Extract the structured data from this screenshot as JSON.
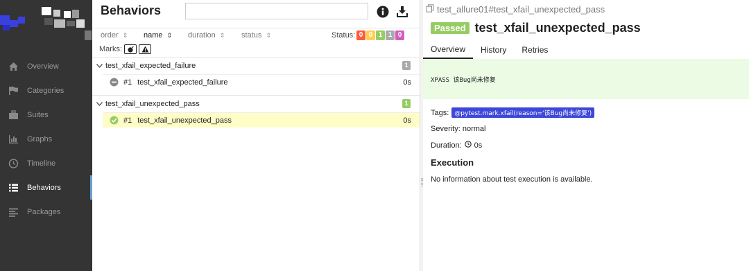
{
  "colors": {
    "sidebar_bg": "#343434",
    "status_failed": "#fd5a3e",
    "status_broken": "#ffd050",
    "status_passed": "#97cc64",
    "status_skipped": "#aaaaaa",
    "status_unknown": "#d35ebe",
    "tag_bg": "#3d47d9",
    "selected_row": "#fefdc7",
    "message_bg": "#ebfbe4"
  },
  "sidebar": {
    "items": [
      {
        "label": "Overview",
        "icon": "home-icon"
      },
      {
        "label": "Categories",
        "icon": "flag-icon"
      },
      {
        "label": "Suites",
        "icon": "briefcase-icon"
      },
      {
        "label": "Graphs",
        "icon": "bar-chart-icon"
      },
      {
        "label": "Timeline",
        "icon": "clock-icon"
      },
      {
        "label": "Behaviors",
        "icon": "list-icon",
        "active": true
      },
      {
        "label": "Packages",
        "icon": "align-left-icon"
      }
    ]
  },
  "behaviors": {
    "title": "Behaviors",
    "search_value": "",
    "sort": {
      "order": "order",
      "name": "name",
      "duration": "duration",
      "status": "status",
      "active": "name"
    },
    "status_label": "Status:",
    "status_counts": {
      "failed": "0",
      "broken": "0",
      "passed": "1",
      "skipped": "1",
      "unknown": "0"
    },
    "marks_label": "Marks:",
    "groups": [
      {
        "name": "test_xfail_expected_failure",
        "count": "1",
        "cases": [
          {
            "num": "#1",
            "name": "test_xfail_expected_failure",
            "duration": "0s",
            "status": "skipped"
          }
        ]
      },
      {
        "name": "test_xfail_unexpected_pass",
        "count": "1",
        "cases": [
          {
            "num": "#1",
            "name": "test_xfail_unexpected_pass",
            "duration": "0s",
            "status": "passed",
            "selected": true
          }
        ]
      }
    ]
  },
  "detail": {
    "breadcrumb": "test_allure01#test_xfail_unexpected_pass",
    "status_badge": "Passed",
    "title": "test_xfail_unexpected_pass",
    "tabs": [
      "Overview",
      "History",
      "Retries"
    ],
    "active_tab": "Overview",
    "message": "XPASS 该Bug尚未修复",
    "tags_label": "Tags:",
    "tag": "@pytest.mark.xfail(reason='该Bug尚未修复')",
    "severity": "Severity: normal",
    "duration_label": "Duration:",
    "duration_value": "0s",
    "execution_title": "Execution",
    "execution_info": "No information about test execution is available."
  }
}
